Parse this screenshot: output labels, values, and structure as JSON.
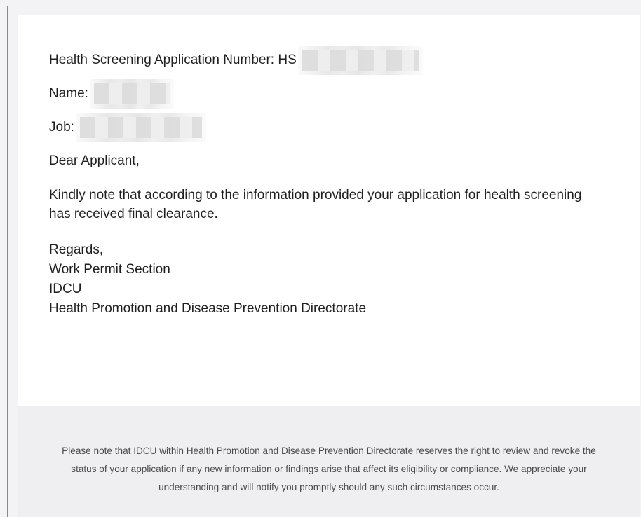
{
  "email": {
    "application_number_label": "Health Screening Application Number: HS",
    "name_label": "Name:",
    "job_label": "Job:",
    "greeting": "Dear Applicant,",
    "body": "Kindly note that according to the information provided your application for health screening has received final clearance.",
    "signature": {
      "closing": "Regards,",
      "section": "Work Permit Section",
      "unit": "IDCU",
      "directorate": "Health Promotion and Disease Prevention Directorate"
    }
  },
  "footer": {
    "notice": "Please note that IDCU within Health Promotion and Disease Prevention Directorate reserves the right to review and revoke the status of your application if any new information or findings arise that affect its eligibility or compliance. We appreciate your understanding and will notify you promptly should any such circumstances occur."
  }
}
